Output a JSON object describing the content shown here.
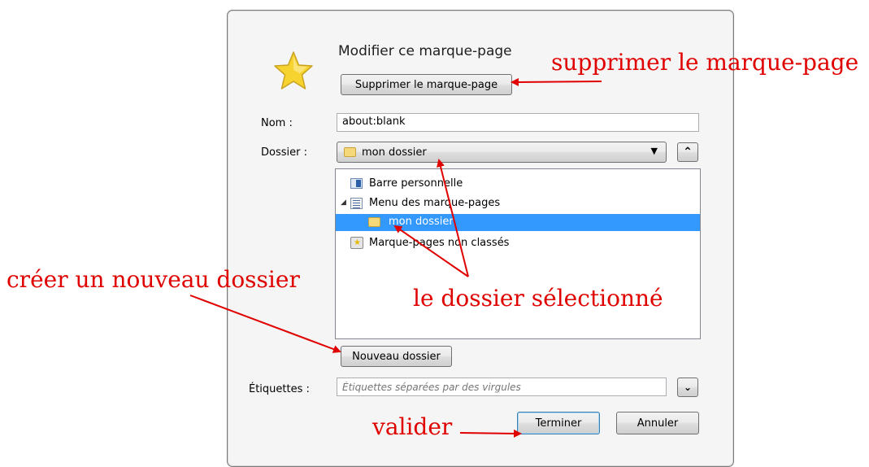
{
  "dialog": {
    "title": "Modifier ce marque-page",
    "remove_button": "Supprimer le marque-page",
    "name_label": "Nom :",
    "name_value": "about:blank",
    "folder_label": "Dossier :",
    "folder_value": "mon dossier",
    "tree": [
      {
        "label": "Barre personnelle",
        "icon": "toolbar-icon"
      },
      {
        "label": "Menu des marque-pages",
        "icon": "menu-icon",
        "expanded": true
      },
      {
        "label": "mon dossier",
        "icon": "folder-icon",
        "selected": true
      },
      {
        "label": "Marque-pages non classés",
        "icon": "unsorted-icon"
      }
    ],
    "new_folder_button": "Nouveau dossier",
    "tags_label": "Étiquettes :",
    "tags_placeholder": "Étiquettes séparées par des virgules",
    "done_button": "Terminer",
    "cancel_button": "Annuler"
  },
  "annotations": {
    "remove": "supprimer le marque-page",
    "new_folder": "créer un nouveau dossier",
    "selected_folder": "le dossier sélectionné",
    "validate": "valider"
  },
  "colors": {
    "annotation": "#e00000",
    "selection": "#3399ff",
    "star": "#f7d32f"
  }
}
